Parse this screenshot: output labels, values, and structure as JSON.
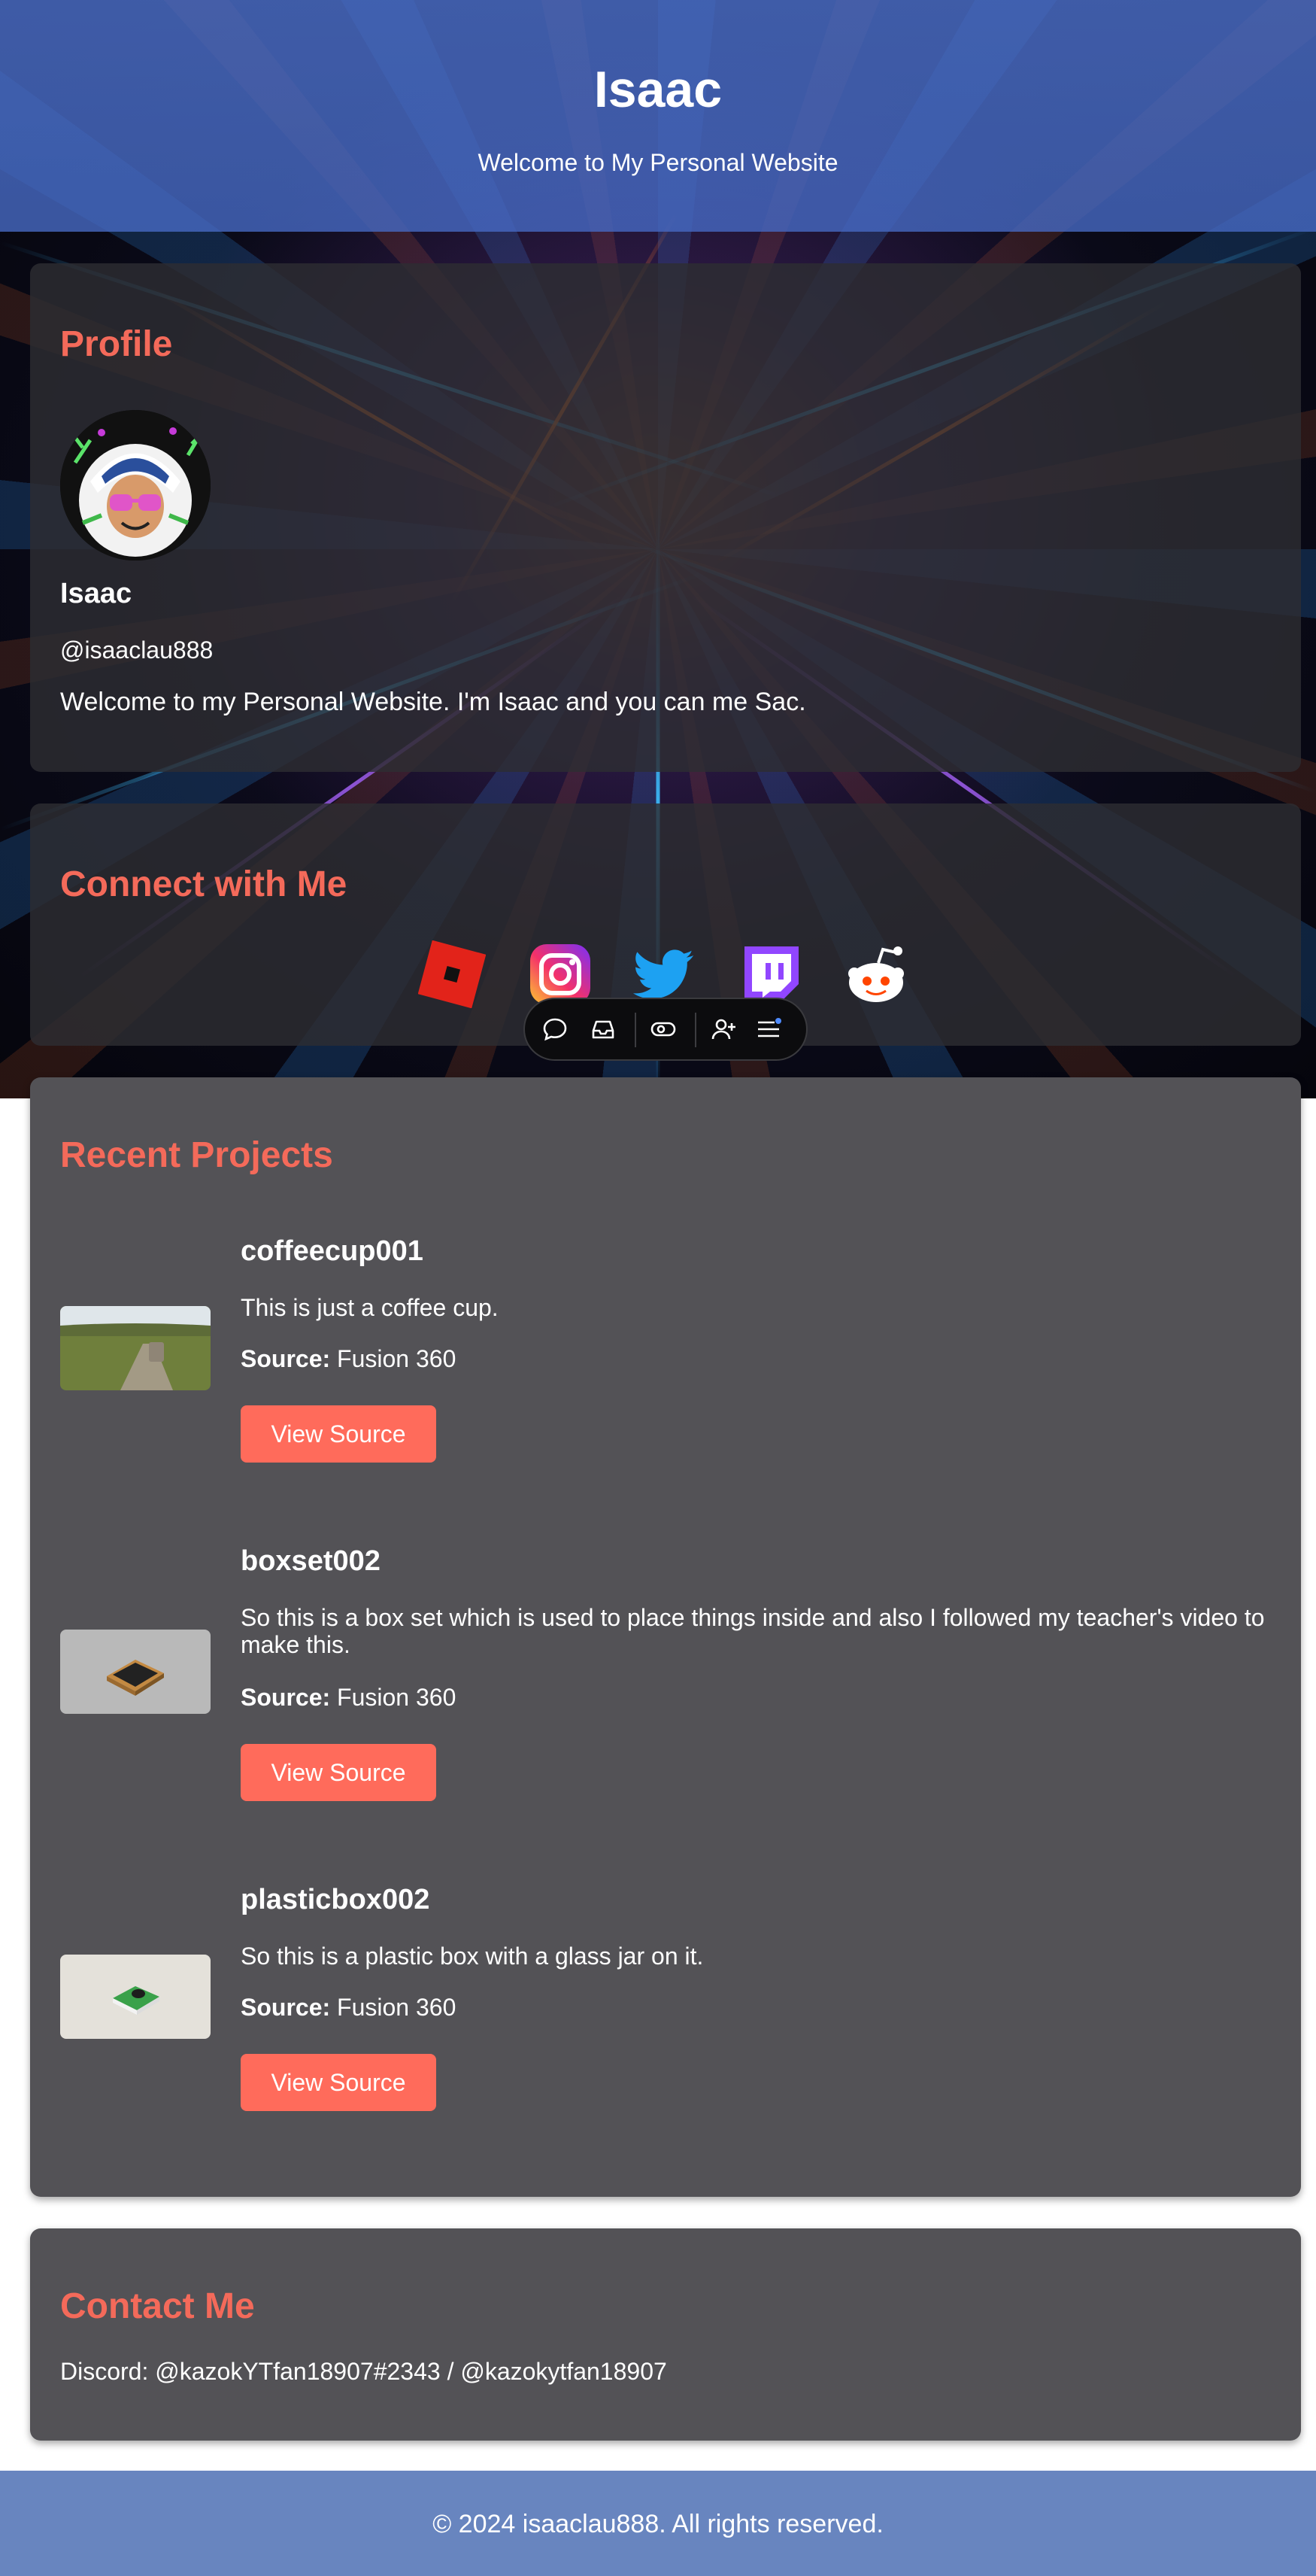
{
  "header": {
    "title": "Isaac",
    "subtitle": "Welcome to My Personal Website"
  },
  "profile": {
    "heading": "Profile",
    "name": "Isaac",
    "handle": "@isaaclau888",
    "bio": "Welcome to my Personal Website. I'm Isaac and you can me Sac."
  },
  "connect": {
    "heading": "Connect with Me",
    "links": [
      {
        "icon": "roblox-icon",
        "color": "#e2231a"
      },
      {
        "icon": "instagram-icon",
        "color": "#d6249f"
      },
      {
        "icon": "twitter-icon",
        "color": "#1da1f2"
      },
      {
        "icon": "twitch-icon",
        "color": "#9146ff"
      },
      {
        "icon": "reddit-icon",
        "color": "#ff4500"
      }
    ]
  },
  "toolbar": {
    "icons": [
      "chat-icon",
      "inbox-icon",
      "toggle-icon",
      "add-user-icon",
      "menu-icon"
    ]
  },
  "projects": {
    "heading": "Recent Projects",
    "source_label": "Source:",
    "button_label": "View Source",
    "items": [
      {
        "title": "coffeecup001",
        "description": "This is just a coffee cup.",
        "source": "Fusion 360"
      },
      {
        "title": "boxset002",
        "description": "So this is a box set which is used to place things inside and also I followed my teacher's video to make this.",
        "source": "Fusion 360"
      },
      {
        "title": "plasticbox002",
        "description": "So this is a plastic box with a glass jar on it.",
        "source": "Fusion 360"
      }
    ]
  },
  "contact": {
    "heading": "Contact Me",
    "line": "Discord: @kazokYTfan18907#2343 / @kazokytfan18907"
  },
  "footer": {
    "text": "© 2024 isaaclau888. All rights reserved."
  },
  "colors": {
    "accent": "#f46a5a",
    "button": "#ff6b5b",
    "header_bg": "#4b6ec8",
    "footer_bg": "#6885bf",
    "card_bg": "#535256"
  }
}
